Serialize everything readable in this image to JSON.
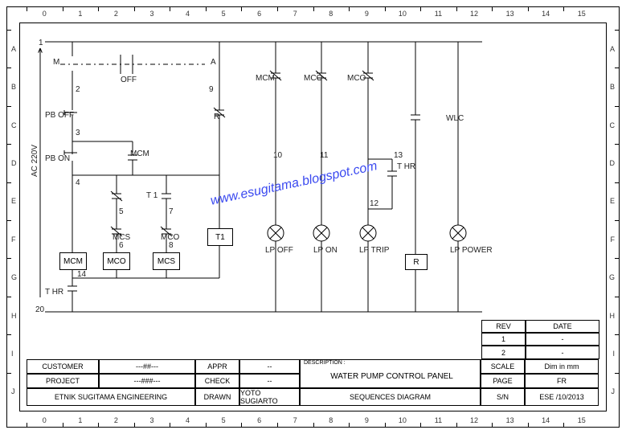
{
  "frame": {
    "cols": [
      "0",
      "1",
      "2",
      "3",
      "4",
      "5",
      "6",
      "7",
      "8",
      "9",
      "10",
      "11",
      "12",
      "13",
      "14",
      "15"
    ],
    "rows": [
      "A",
      "B",
      "C",
      "D",
      "E",
      "F",
      "G",
      "H",
      "I",
      "J"
    ]
  },
  "schematic": {
    "yaxis_label": "AC 220V",
    "yaxis_top": "1",
    "yaxis_bottom": "20",
    "nodes": {
      "n2": "2",
      "n3": "3",
      "n4": "4",
      "n5": "5",
      "n6": "6",
      "n7": "7",
      "n8": "8",
      "n9": "9",
      "n10": "10",
      "n11": "11",
      "n12": "12",
      "n13": "13",
      "n14": "14"
    },
    "labels": {
      "M": "M",
      "A": "A",
      "OFF": "OFF",
      "R": "R",
      "PB_OFF": "PB OFF",
      "PB_ON": "PB ON",
      "MCM_contact": "MCM",
      "T1_contact": "T 1",
      "MCS": "MCS",
      "MCO_A": "MCO",
      "MCM_coil": "MCM",
      "MCO_coil": "MCO",
      "MCS_coil": "MCS",
      "T1_coil": "T1",
      "THR": "T HR",
      "MCM_top": "MCM",
      "MCO_top1": "MCO",
      "MCO_top2": "MCO",
      "WLC": "WLC",
      "THR_top": "T HR",
      "LP_OFF": "LP OFF",
      "LP_ON": "LP ON",
      "LP_TRIP": "LP TRIP",
      "R_coil": "R",
      "LP_POWER": "LP POWER"
    }
  },
  "watermark": "www.esugitama.blogspot.com",
  "titleblock": {
    "customer_l": "CUSTOMER",
    "customer_v": "---##---",
    "project_l": "PROJECT",
    "project_v": "---###---",
    "company": "ETNIK SUGITAMA ENGINEERING",
    "appr_l": "APPR",
    "appr_v": "--",
    "check_l": "CHECK",
    "check_v": "--",
    "drawn_l": "DRAWN",
    "drawn_v": "YOTO SUGIARTO",
    "desc_l": "DESCRIPTION :",
    "desc1": "WATER PUMP CONTROL PANEL",
    "desc2": "SEQUENCES  DIAGRAM",
    "rev_h": "REV",
    "date_h": "DATE",
    "rev1": "1",
    "date1": "-",
    "rev2": "2",
    "date2": "-",
    "scale_l": "SCALE",
    "scale_v": "Dim in mm",
    "page_l": "PAGE",
    "page_v": "FR",
    "sn_l": "S/N",
    "sn_v": "ESE /10/2013"
  }
}
